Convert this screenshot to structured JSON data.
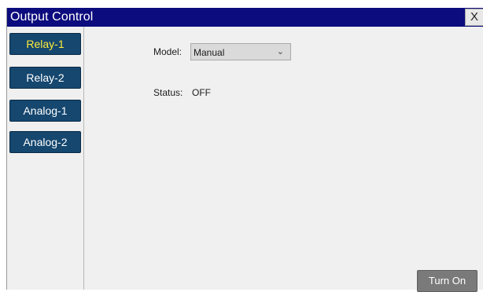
{
  "window": {
    "title": "Output Control",
    "close_label": "X"
  },
  "colors": {
    "titlebar": "#0c0c7e",
    "nav_button": "#15476f",
    "active_text": "#ffec3a",
    "action_button": "#7a7a7a"
  },
  "sidebar": {
    "items": [
      {
        "label": "Relay-1",
        "active": true
      },
      {
        "label": "Relay-2",
        "active": false
      },
      {
        "label": "Analog-1",
        "active": false
      },
      {
        "label": "Analog-2",
        "active": false
      }
    ]
  },
  "main": {
    "model_label": "Model:",
    "model_value": "Manual",
    "status_label": "Status:",
    "status_value": "OFF",
    "turn_on_label": "Turn On"
  },
  "icons": {
    "dropdown": "chevron-down-icon"
  }
}
